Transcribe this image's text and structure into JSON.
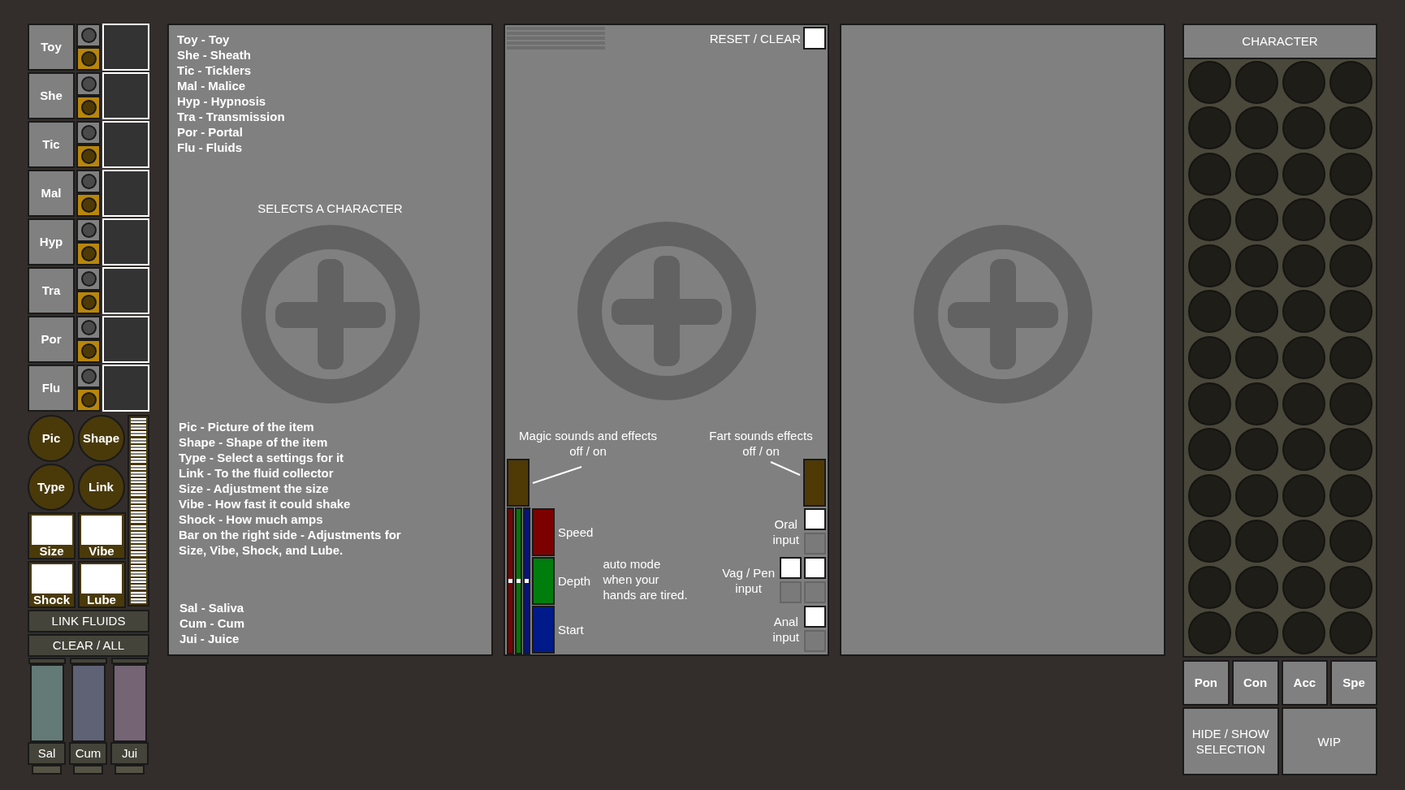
{
  "sidebar": {
    "rows": [
      {
        "label": "Toy"
      },
      {
        "label": "She"
      },
      {
        "label": "Tic"
      },
      {
        "label": "Mal"
      },
      {
        "label": "Hyp"
      },
      {
        "label": "Tra"
      },
      {
        "label": "Por"
      },
      {
        "label": "Flu"
      }
    ],
    "round_buttons": [
      "Pic",
      "Shape",
      "Type",
      "Link"
    ],
    "setting_buttons": [
      "Size",
      "Vibe",
      "Shock",
      "Lube"
    ],
    "actions": [
      "LINK FLUIDS",
      "CLEAR / ALL"
    ],
    "fluids": [
      {
        "label": "Sal",
        "color": "#647a77"
      },
      {
        "label": "Cum",
        "color": "#5f6275"
      },
      {
        "label": "Jui",
        "color": "#746474"
      }
    ]
  },
  "legend_panel": {
    "abbreviations": [
      "Toy - Toy",
      "She - Sheath",
      "Tic - Ticklers",
      "Mal - Malice",
      "Hyp - Hypnosis",
      "Tra - Transmission",
      "Por - Portal",
      "Flu - Fluids"
    ],
    "heading": "SELECTS A CHARACTER",
    "help": [
      "Pic - Picture of the item",
      "Shape - Shape of the item",
      "Type - Select a settings for it",
      "Link - To the fluid collector",
      "Size - Adjustment the size",
      "Vibe - How fast  it could shake",
      "Shock - How much amps",
      "Bar on the right side - Adjustments for",
      "Size, Vibe, Shock, and Lube."
    ],
    "fluid_help": [
      "Sal - Saliva",
      "Cum - Cum",
      "Jui - Juice"
    ]
  },
  "control_panel": {
    "reset_label": "RESET / CLEAR",
    "reset_checked": false,
    "magic": {
      "title": "Magic sounds and effects",
      "hint": "off / on"
    },
    "fart": {
      "title": "Fart sounds effects",
      "hint": "off / on"
    },
    "sliders": [
      {
        "color": "#7a0000",
        "level": 0.5
      },
      {
        "color": "#007a00",
        "level": 0.5
      },
      {
        "color": "#00138a",
        "level": 0.5
      }
    ],
    "modes": [
      {
        "label": "Speed",
        "color": "#7d0000"
      },
      {
        "label": "Depth",
        "color": "#007d0d"
      },
      {
        "label": "Start",
        "color": "#001a8a"
      }
    ],
    "auto_note": "auto mode\nwhen your\nhands are tired.",
    "inputs": [
      {
        "label": "Oral\ninput",
        "kind": "single",
        "slots": [
          {
            "disabled": false
          },
          {
            "disabled": true
          }
        ]
      },
      {
        "label": "Vag / Pen\ninput",
        "kind": "double",
        "slots": [
          {
            "disabled": false
          },
          {
            "disabled": false
          },
          {
            "disabled": true
          },
          {
            "disabled": true
          }
        ]
      },
      {
        "label": "Anal\ninput",
        "kind": "single",
        "slots": [
          {
            "disabled": false
          },
          {
            "disabled": true
          }
        ]
      }
    ]
  },
  "character_panel": {
    "title": "CHARACTER",
    "slots": [
      {
        "kind": "empty"
      },
      {
        "kind": "empty"
      },
      {
        "kind": "empty"
      },
      {
        "kind": "empty"
      },
      {
        "kind": "empty"
      },
      {
        "kind": "empty"
      },
      {
        "kind": "empty"
      },
      {
        "kind": "empty"
      },
      {
        "kind": "empty"
      },
      {
        "kind": "empty"
      },
      {
        "kind": "empty"
      },
      {
        "kind": "empty"
      },
      {
        "kind": "empty"
      },
      {
        "kind": "empty"
      },
      {
        "kind": "empty"
      },
      {
        "kind": "empty"
      },
      {
        "kind": "empty"
      },
      {
        "kind": "empty"
      },
      {
        "kind": "empty"
      },
      {
        "kind": "empty"
      },
      {
        "kind": "empty"
      },
      {
        "kind": "empty"
      },
      {
        "kind": "empty"
      },
      {
        "kind": "empty"
      },
      {
        "kind": "empty"
      },
      {
        "kind": "empty"
      },
      {
        "kind": "empty"
      },
      {
        "kind": "empty"
      },
      {
        "kind": "empty"
      },
      {
        "kind": "empty"
      },
      {
        "kind": "empty"
      },
      {
        "kind": "empty"
      },
      {
        "kind": "empty"
      },
      {
        "kind": "empty"
      },
      {
        "kind": "empty"
      },
      {
        "kind": "empty"
      },
      {
        "kind": "empty"
      },
      {
        "kind": "empty"
      },
      {
        "kind": "empty"
      },
      {
        "kind": "empty"
      },
      {
        "kind": "empty"
      },
      {
        "kind": "empty"
      },
      {
        "kind": "empty"
      },
      {
        "kind": "empty"
      },
      {
        "kind": "empty"
      },
      {
        "kind": "empty"
      },
      {
        "kind": "empty"
      },
      {
        "kind": "empty"
      },
      {
        "kind": "empty"
      },
      {
        "kind": "empty"
      },
      {
        "kind": "empty"
      },
      {
        "kind": "empty"
      }
    ],
    "categories": [
      "Pon",
      "Con",
      "Acc",
      "Spe"
    ],
    "buttons": [
      "HIDE / SHOW\nSELECTION",
      "WIP"
    ]
  }
}
